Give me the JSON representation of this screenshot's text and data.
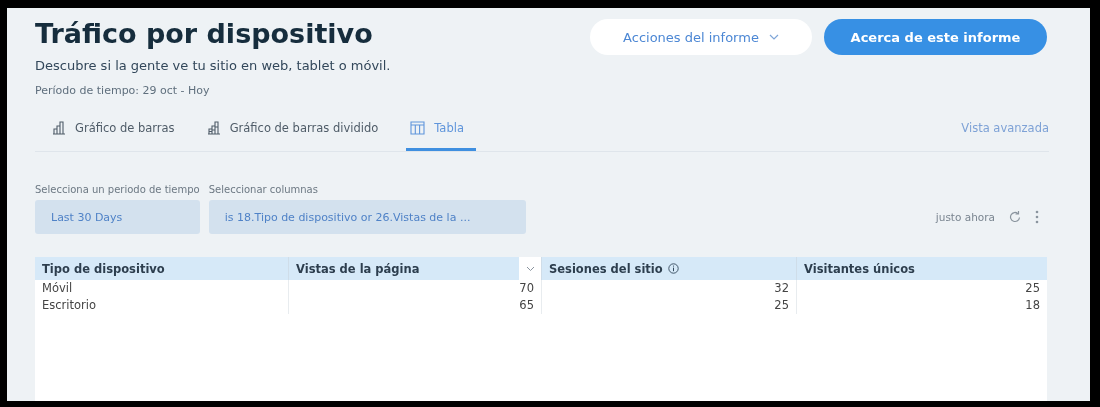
{
  "header": {
    "title": "Tráfico por dispositivo",
    "subtitle": "Descubre si la gente ve tu sitio en web, tablet o móvil.",
    "period": "Período de tiempo: 29 oct - Hoy"
  },
  "actions": [
    {
      "kind": "menu",
      "label": "Acciones del informe"
    },
    {
      "kind": "primary",
      "label": "Acerca de este informe"
    }
  ],
  "tabs": [
    {
      "kind": "bars",
      "label": "Gráfico de barras",
      "selected": false
    },
    {
      "kind": "split",
      "label": "Gráfico de barras dividido",
      "selected": false
    },
    {
      "kind": "table",
      "label": "Tabla",
      "selected": true
    }
  ],
  "advanced_link": "Vista avanzada",
  "filters": [
    {
      "label": "Selecciona un periodo de tiempo",
      "value": "Last 30 Days"
    },
    {
      "label": "Seleccionar columnas",
      "value": "is 18.Tipo de dispositivo or 26.Vistas de la ..."
    }
  ],
  "updated": "justo ahora",
  "table": {
    "columns": [
      {
        "label": "Tipo de dispositivo",
        "sort_menu": false,
        "info_icon": false
      },
      {
        "label": "Vistas de la página",
        "sort_menu": true,
        "info_icon": false
      },
      {
        "label": "Sesiones del sitio",
        "sort_menu": false,
        "info_icon": true
      },
      {
        "label": "Visitantes únicos",
        "sort_menu": false,
        "info_icon": false
      }
    ],
    "rows": [
      [
        "Móvil",
        "70",
        "32",
        "25"
      ],
      [
        "Escritorio",
        "65",
        "25",
        "18"
      ]
    ]
  }
}
